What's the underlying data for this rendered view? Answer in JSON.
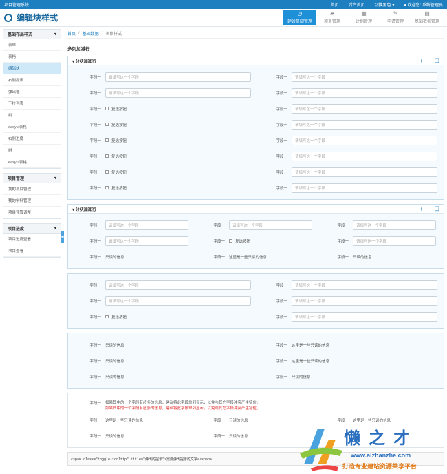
{
  "app_title": "项目管理系统",
  "topnav": [
    "首页",
    "后台首页",
    "切换角色 ▾",
    "欢迎您: 系统管理员"
  ],
  "header_title": "编辑块样式",
  "mainnav": [
    {
      "label": "建设贝脚管理",
      "icon": "clock-icon",
      "active": true
    },
    {
      "label": "项目管理",
      "icon": "folder-icon",
      "active": false
    },
    {
      "label": "计划管理",
      "icon": "calendar-icon",
      "active": false
    },
    {
      "label": "申请管理",
      "icon": "pencil-icon",
      "active": false
    },
    {
      "label": "基础数据管理",
      "icon": "grid-icon",
      "active": false
    }
  ],
  "sidebar": [
    {
      "title": "基础布局样式",
      "items": [
        "表单",
        "表格",
        "编辑块",
        "右侧提示",
        "弹出框",
        "下拉列表",
        "树",
        "easyui表格",
        "右侧进度",
        "树",
        "easyui表格"
      ],
      "active": 2
    },
    {
      "title": "项目管理",
      "items": [
        "我的项目管理",
        "我的学科管理",
        "项目预算调整"
      ],
      "active": -1
    },
    {
      "title": "项目进度",
      "items": [
        "项目进度查看",
        "项目查看"
      ],
      "active": -1
    }
  ],
  "breadcrumb": [
    "首页",
    "基础数据",
    "表格样式"
  ],
  "page_title": "多列加减行",
  "panel1_title": "分块加减行",
  "panel2_title": "分块加减行",
  "field_label": "字段一",
  "placeholder": "请填写这一个字段",
  "checkbox_label": "复选按钮",
  "readonly_text": "只读的信息",
  "readonly_text_alt": "这里是一些只读的信息",
  "readonly_long": "这里是一些只读的信息",
  "note_text": "如果其中的一个字段有超多的信息，建议将此字段单列显示，以免与其它字段冲突产生错位。",
  "code_text": "<span class=\"toggle-tooltip\" title=\"弹出的提示\">需要弹出提示的文字</span>",
  "watermark": {
    "name": "懒之才",
    "url": "www.aizhanzhe.com",
    "slogan": "打造专业建站资源共享平台"
  }
}
